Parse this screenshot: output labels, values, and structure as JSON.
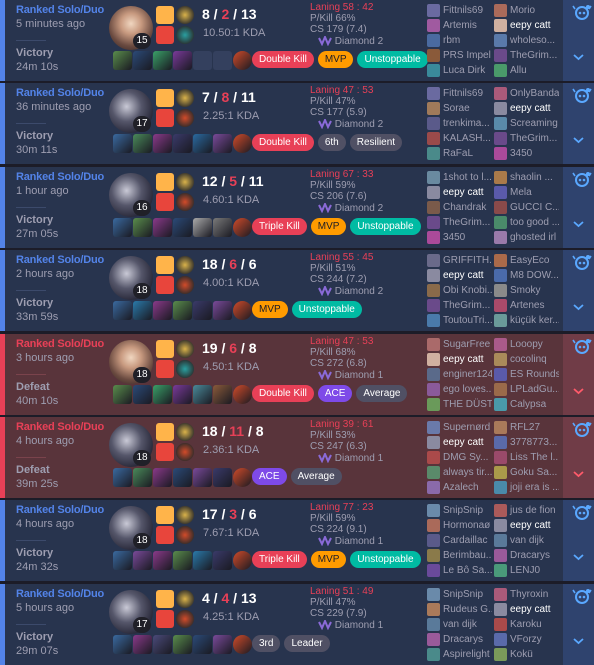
{
  "matches": [
    {
      "result_type": "win",
      "queue": "Ranked Solo/Duo",
      "time_ago": "5 minutes ago",
      "result": "Victory",
      "duration": "24m 10s",
      "champ_style": "bright",
      "level": "15",
      "kills": "8",
      "deaths": "2",
      "assists": "13",
      "kda_ratio": "10.50:1 KDA",
      "spells": [
        "#ffb44a",
        "#e8453c"
      ],
      "runes": [
        "#d9b24a",
        "#2a9fa0"
      ],
      "items": [
        "#5a8d4c",
        "#2b4a78",
        "#3aa068",
        "#7a3a9a",
        "empty",
        "empty",
        "#d14b2a"
      ],
      "badges": [
        {
          "label": "Double Kill",
          "color": "red"
        },
        {
          "label": "MVP",
          "color": "orange"
        },
        {
          "label": "Unstoppable",
          "color": "green"
        }
      ],
      "laning": "Laning 58 : 42",
      "pkill": "P/Kill 66%",
      "cs": "CS 179 (7.4)",
      "rank": "Diamond 2",
      "team1": [
        {
          "name": "Fittnils69",
          "me": false,
          "icon": "#6a6aa0"
        },
        {
          "name": "Artemis",
          "me": false,
          "icon": "#a05aa0"
        },
        {
          "name": "rbm",
          "me": false,
          "icon": "#4a6aa0"
        },
        {
          "name": "PRS Impel",
          "me": false,
          "icon": "#8a5a3a"
        },
        {
          "name": "Luca Dirk",
          "me": false,
          "icon": "#3a8a9a"
        }
      ],
      "team2": [
        {
          "name": "Morio",
          "me": false,
          "icon": "#aa6a5a"
        },
        {
          "name": "eepy catt",
          "me": true,
          "icon": "#d0b0a0"
        },
        {
          "name": "wholeso...",
          "me": false,
          "icon": "#5a7aaa"
        },
        {
          "name": "TheGrim...",
          "me": false,
          "icon": "#6a4a8a"
        },
        {
          "name": "Allu",
          "me": false,
          "icon": "#4a9a6a"
        }
      ]
    },
    {
      "result_type": "win",
      "queue": "Ranked Solo/Duo",
      "time_ago": "36 minutes ago",
      "result": "Victory",
      "duration": "30m 11s",
      "champ_style": "dark",
      "level": "17",
      "kills": "7",
      "deaths": "8",
      "assists": "11",
      "kda_ratio": "2.25:1 KDA",
      "spells": [
        "#ffb44a",
        "#e8453c"
      ],
      "runes": [
        "#d9b24a",
        "#d14b2a"
      ],
      "items": [
        "#3a6aa0",
        "#4a8a5a",
        "#8a3a8a",
        "#3a3a6a",
        "#2a6aa0",
        "#7a4a9a",
        "#d14b2a"
      ],
      "badges": [
        {
          "label": "Double Kill",
          "color": "red"
        },
        {
          "label": "6th",
          "color": "gray"
        },
        {
          "label": "Resilient",
          "color": "gray"
        }
      ],
      "laning": "Laning 47 : 53",
      "pkill": "P/Kill 47%",
      "cs": "CS 177 (5.9)",
      "rank": "Diamond 2",
      "team1": [
        {
          "name": "Fittnils69",
          "me": false,
          "icon": "#6a6aa0"
        },
        {
          "name": "Sorae",
          "me": false,
          "icon": "#a07a5a"
        },
        {
          "name": "trenkima...",
          "me": false,
          "icon": "#5a5a8a"
        },
        {
          "name": "KALASH...",
          "me": false,
          "icon": "#9a4a4a"
        },
        {
          "name": "RaFaL",
          "me": false,
          "icon": "#4a8a8a"
        }
      ],
      "team2": [
        {
          "name": "OnlyBanda",
          "me": false,
          "icon": "#aa5a7a"
        },
        {
          "name": "eepy catt",
          "me": true,
          "icon": "#8a8aa0"
        },
        {
          "name": "Screaming",
          "me": false,
          "icon": "#5a8aaa"
        },
        {
          "name": "TheGrim...",
          "me": false,
          "icon": "#6a4a8a"
        },
        {
          "name": "3450",
          "me": false,
          "icon": "#aa4a9a"
        }
      ]
    },
    {
      "result_type": "win",
      "queue": "Ranked Solo/Duo",
      "time_ago": "1 hour ago",
      "result": "Victory",
      "duration": "27m 05s",
      "champ_style": "dark",
      "level": "16",
      "kills": "12",
      "deaths": "5",
      "assists": "11",
      "kda_ratio": "4.60:1 KDA",
      "spells": [
        "#ffb44a",
        "#e8453c"
      ],
      "runes": [
        "#d9b24a",
        "#d14b2a"
      ],
      "items": [
        "#3a6aa0",
        "#5a8d4c",
        "#8a3a8a",
        "#2b4a78",
        "#aaaaaa",
        "#7a7a7a",
        "#d14b2a"
      ],
      "badges": [
        {
          "label": "Triple Kill",
          "color": "red"
        },
        {
          "label": "MVP",
          "color": "orange"
        },
        {
          "label": "Unstoppable",
          "color": "green"
        }
      ],
      "laning": "Laning 67 : 33",
      "pkill": "P/Kill 59%",
      "cs": "CS 206 (7.6)",
      "rank": "Diamond 2",
      "team1": [
        {
          "name": "1shot to l...",
          "me": false,
          "icon": "#6a8aa0"
        },
        {
          "name": "eepy catt",
          "me": true,
          "icon": "#8a8aa0"
        },
        {
          "name": "Chandrak",
          "me": false,
          "icon": "#7a5a4a"
        },
        {
          "name": "TheGrim...",
          "me": false,
          "icon": "#6a4a8a"
        },
        {
          "name": "3450",
          "me": false,
          "icon": "#aa4a9a"
        }
      ],
      "team2": [
        {
          "name": "shaolin ...",
          "me": false,
          "icon": "#aa7a4a"
        },
        {
          "name": "Mela",
          "me": false,
          "icon": "#5a5aaa"
        },
        {
          "name": "GUCCI C...",
          "me": false,
          "icon": "#8a4a4a"
        },
        {
          "name": "too good ...",
          "me": false,
          "icon": "#4a8a6a"
        },
        {
          "name": "ghosted irl",
          "me": false,
          "icon": "#9a7aaa"
        }
      ]
    },
    {
      "result_type": "win",
      "queue": "Ranked Solo/Duo",
      "time_ago": "2 hours ago",
      "result": "Victory",
      "duration": "33m 59s",
      "champ_style": "dark",
      "level": "18",
      "kills": "18",
      "deaths": "6",
      "assists": "6",
      "kda_ratio": "4.00:1 KDA",
      "spells": [
        "#ffb44a",
        "#e8453c"
      ],
      "runes": [
        "#d9b24a",
        "#d14b2a"
      ],
      "items": [
        "#3a6aa0",
        "#2a7aaa",
        "#8a3a8a",
        "#5a8d4c",
        "#3a3a6a",
        "#7a4a9a",
        "#d14b2a"
      ],
      "badges": [
        {
          "label": "MVP",
          "color": "orange"
        },
        {
          "label": "Unstoppable",
          "color": "green"
        }
      ],
      "laning": "Laning 55 : 45",
      "pkill": "P/Kill 51%",
      "cs": "CS 244 (7.2)",
      "rank": "Diamond 2",
      "team1": [
        {
          "name": "GRIFFITH...",
          "me": false,
          "icon": "#6a6a8a"
        },
        {
          "name": "eepy catt",
          "me": true,
          "icon": "#8a8aa0"
        },
        {
          "name": "Obi Knobi...",
          "me": false,
          "icon": "#8a6a4a"
        },
        {
          "name": "TheGrim...",
          "me": false,
          "icon": "#6a4a8a"
        },
        {
          "name": "ToutouTri...",
          "me": false,
          "icon": "#4a7aaa"
        }
      ],
      "team2": [
        {
          "name": "EasyEco",
          "me": false,
          "icon": "#aa6a4a"
        },
        {
          "name": "M8 DOW...",
          "me": false,
          "icon": "#4a6aaa"
        },
        {
          "name": "Smoky",
          "me": false,
          "icon": "#8a8a8a"
        },
        {
          "name": "Artenes",
          "me": false,
          "icon": "#aa4a6a"
        },
        {
          "name": "küçük ker...",
          "me": false,
          "icon": "#6a9a9a"
        }
      ]
    },
    {
      "result_type": "loss",
      "queue": "Ranked Solo/Duo",
      "time_ago": "3 hours ago",
      "result": "Defeat",
      "duration": "40m 10s",
      "champ_style": "bright",
      "level": "18",
      "kills": "19",
      "deaths": "6",
      "assists": "8",
      "kda_ratio": "4.50:1 KDA",
      "spells": [
        "#ffb44a",
        "#e8453c"
      ],
      "runes": [
        "#d9b24a",
        "#2a9fa0"
      ],
      "items": [
        "#5a8d4c",
        "#2b4a78",
        "#3aa068",
        "#7a3a9a",
        "#4a8a9a",
        "#8a5a3a",
        "#d14b2a"
      ],
      "badges": [
        {
          "label": "Double Kill",
          "color": "red"
        },
        {
          "label": "ACE",
          "color": "purple"
        },
        {
          "label": "Average",
          "color": "gray"
        }
      ],
      "laning": "Laning 47 : 53",
      "pkill": "P/Kill 68%",
      "cs": "CS 272 (6.8)",
      "rank": "Diamond 1",
      "team1": [
        {
          "name": "SugarFree",
          "me": false,
          "icon": "#aa6a6a"
        },
        {
          "name": "eepy catt",
          "me": true,
          "icon": "#d0b0a0"
        },
        {
          "name": "enginer124",
          "me": false,
          "icon": "#5a6a8a"
        },
        {
          "name": "ego loves...",
          "me": false,
          "icon": "#8a5a9a"
        },
        {
          "name": "THE DÜST",
          "me": false,
          "icon": "#6a9a5a"
        }
      ],
      "team2": [
        {
          "name": "Looopy",
          "me": false,
          "icon": "#aa5a8a"
        },
        {
          "name": "cocolinq",
          "me": false,
          "icon": "#aa8a5a"
        },
        {
          "name": "ES Rounds",
          "me": false,
          "icon": "#5a5aaa"
        },
        {
          "name": "LPLadGu...",
          "me": false,
          "icon": "#9a6a4a"
        },
        {
          "name": "Calypsa",
          "me": false,
          "icon": "#4a9aaa"
        }
      ]
    },
    {
      "result_type": "loss",
      "queue": "Ranked Solo/Duo",
      "time_ago": "4 hours ago",
      "result": "Defeat",
      "duration": "39m 25s",
      "champ_style": "dark",
      "level": "18",
      "kills": "18",
      "deaths": "11",
      "assists": "8",
      "kda_ratio": "2.36:1 KDA",
      "spells": [
        "#ffb44a",
        "#e8453c"
      ],
      "runes": [
        "#d9b24a",
        "#d14b2a"
      ],
      "items": [
        "#3a6aa0",
        "#4a8a5a",
        "#8a3a8a",
        "#2b4a78",
        "#7a4a9a",
        "#3a3a6a",
        "#d14b2a"
      ],
      "badges": [
        {
          "label": "ACE",
          "color": "purple"
        },
        {
          "label": "Average",
          "color": "gray"
        }
      ],
      "laning": "Laning 39 : 61",
      "pkill": "P/Kill 53%",
      "cs": "CS 247 (6.3)",
      "rank": "Diamond 1",
      "team1": [
        {
          "name": "Supernørd",
          "me": false,
          "icon": "#6a7aaa"
        },
        {
          "name": "eepy catt",
          "me": true,
          "icon": "#8a8aa0"
        },
        {
          "name": "DMG Sy...",
          "me": false,
          "icon": "#aa4a4a"
        },
        {
          "name": "always tir...",
          "me": false,
          "icon": "#5a8a6a"
        },
        {
          "name": "Azalech",
          "me": false,
          "icon": "#8a6aaa"
        }
      ],
      "team2": [
        {
          "name": "RFL27",
          "me": false,
          "icon": "#aa7a5a"
        },
        {
          "name": "3778773...",
          "me": false,
          "icon": "#5a6aaa"
        },
        {
          "name": "Liss The l...",
          "me": false,
          "icon": "#9a4a6a"
        },
        {
          "name": "Goku Sa...",
          "me": false,
          "icon": "#aa9a4a"
        },
        {
          "name": "joji era is ...",
          "me": false,
          "icon": "#4a8aaa"
        }
      ]
    },
    {
      "result_type": "win",
      "queue": "Ranked Solo/Duo",
      "time_ago": "4 hours ago",
      "result": "Victory",
      "duration": "24m 32s",
      "champ_style": "dark",
      "level": "18",
      "kills": "17",
      "deaths": "3",
      "assists": "6",
      "kda_ratio": "7.67:1 KDA",
      "spells": [
        "#ffb44a",
        "#e8453c"
      ],
      "runes": [
        "#d9b24a",
        "#d14b2a"
      ],
      "items": [
        "#3a6aa0",
        "#7a4a9a",
        "#8a3a8a",
        "#5a8d4c",
        "#2a7aaa",
        "#3a3a6a",
        "#d14b2a"
      ],
      "badges": [
        {
          "label": "Triple Kill",
          "color": "red"
        },
        {
          "label": "MVP",
          "color": "orange"
        },
        {
          "label": "Unstoppable",
          "color": "green"
        }
      ],
      "laning": "Laning 77 : 23",
      "pkill": "P/Kill 59%",
      "cs": "CS 224 (9.1)",
      "rank": "Diamond 1",
      "team1": [
        {
          "name": "SnipSnip",
          "me": false,
          "icon": "#6a8aaa"
        },
        {
          "name": "Hormonaø",
          "me": false,
          "icon": "#aa6a5a"
        },
        {
          "name": "Cardaillac",
          "me": false,
          "icon": "#5a5a8a"
        },
        {
          "name": "Berimbau...",
          "me": false,
          "icon": "#8a7a4a"
        },
        {
          "name": "Le Bô Sa...",
          "me": false,
          "icon": "#6a4a9a"
        }
      ],
      "team2": [
        {
          "name": "jus de fion",
          "me": false,
          "icon": "#aa5a5a"
        },
        {
          "name": "eepy catt",
          "me": true,
          "icon": "#8a8aa0"
        },
        {
          "name": "van dijk",
          "me": false,
          "icon": "#5a7a9a"
        },
        {
          "name": "Dracarys",
          "me": false,
          "icon": "#9a5a9a"
        },
        {
          "name": "LENJ0",
          "me": false,
          "icon": "#4a9a7a"
        }
      ]
    },
    {
      "result_type": "win",
      "queue": "Ranked Solo/Duo",
      "time_ago": "5 hours ago",
      "result": "Victory",
      "duration": "29m 07s",
      "champ_style": "dark",
      "level": "17",
      "kills": "4",
      "deaths": "4",
      "assists": "13",
      "kda_ratio": "4.25:1 KDA",
      "spells": [
        "#ffb44a",
        "#e8453c"
      ],
      "runes": [
        "#d9b24a",
        "#d14b2a"
      ],
      "items": [
        "#3a6aa0",
        "#8a3a8a",
        "#4a4a7a",
        "#5a8d4c",
        "#2b4a78",
        "#7a4a9a",
        "#d14b2a"
      ],
      "badges": [
        {
          "label": "3rd",
          "color": "gray"
        },
        {
          "label": "Leader",
          "color": "gray"
        }
      ],
      "laning": "Laning 51 : 49",
      "pkill": "P/Kill 47%",
      "cs": "CS 229 (7.9)",
      "rank": "Diamond 1",
      "team1": [
        {
          "name": "SnipSnip",
          "me": false,
          "icon": "#6a8aaa"
        },
        {
          "name": "Rudeus G...",
          "me": false,
          "icon": "#aa7a5a"
        },
        {
          "name": "van dijk",
          "me": false,
          "icon": "#5a7a9a"
        },
        {
          "name": "Dracarys",
          "me": false,
          "icon": "#9a5a9a"
        },
        {
          "name": "Aspirelight",
          "me": false,
          "icon": "#4a8a8a"
        }
      ],
      "team2": [
        {
          "name": "Thyroxin",
          "me": false,
          "icon": "#aa5a7a"
        },
        {
          "name": "eepy catt",
          "me": true,
          "icon": "#8a8aa0"
        },
        {
          "name": "Karoku",
          "me": false,
          "icon": "#aa4a4a"
        },
        {
          "name": "VForzy",
          "me": false,
          "icon": "#5a6aaa"
        },
        {
          "name": "Kokü",
          "me": false,
          "icon": "#7a9a5a"
        }
      ]
    }
  ]
}
